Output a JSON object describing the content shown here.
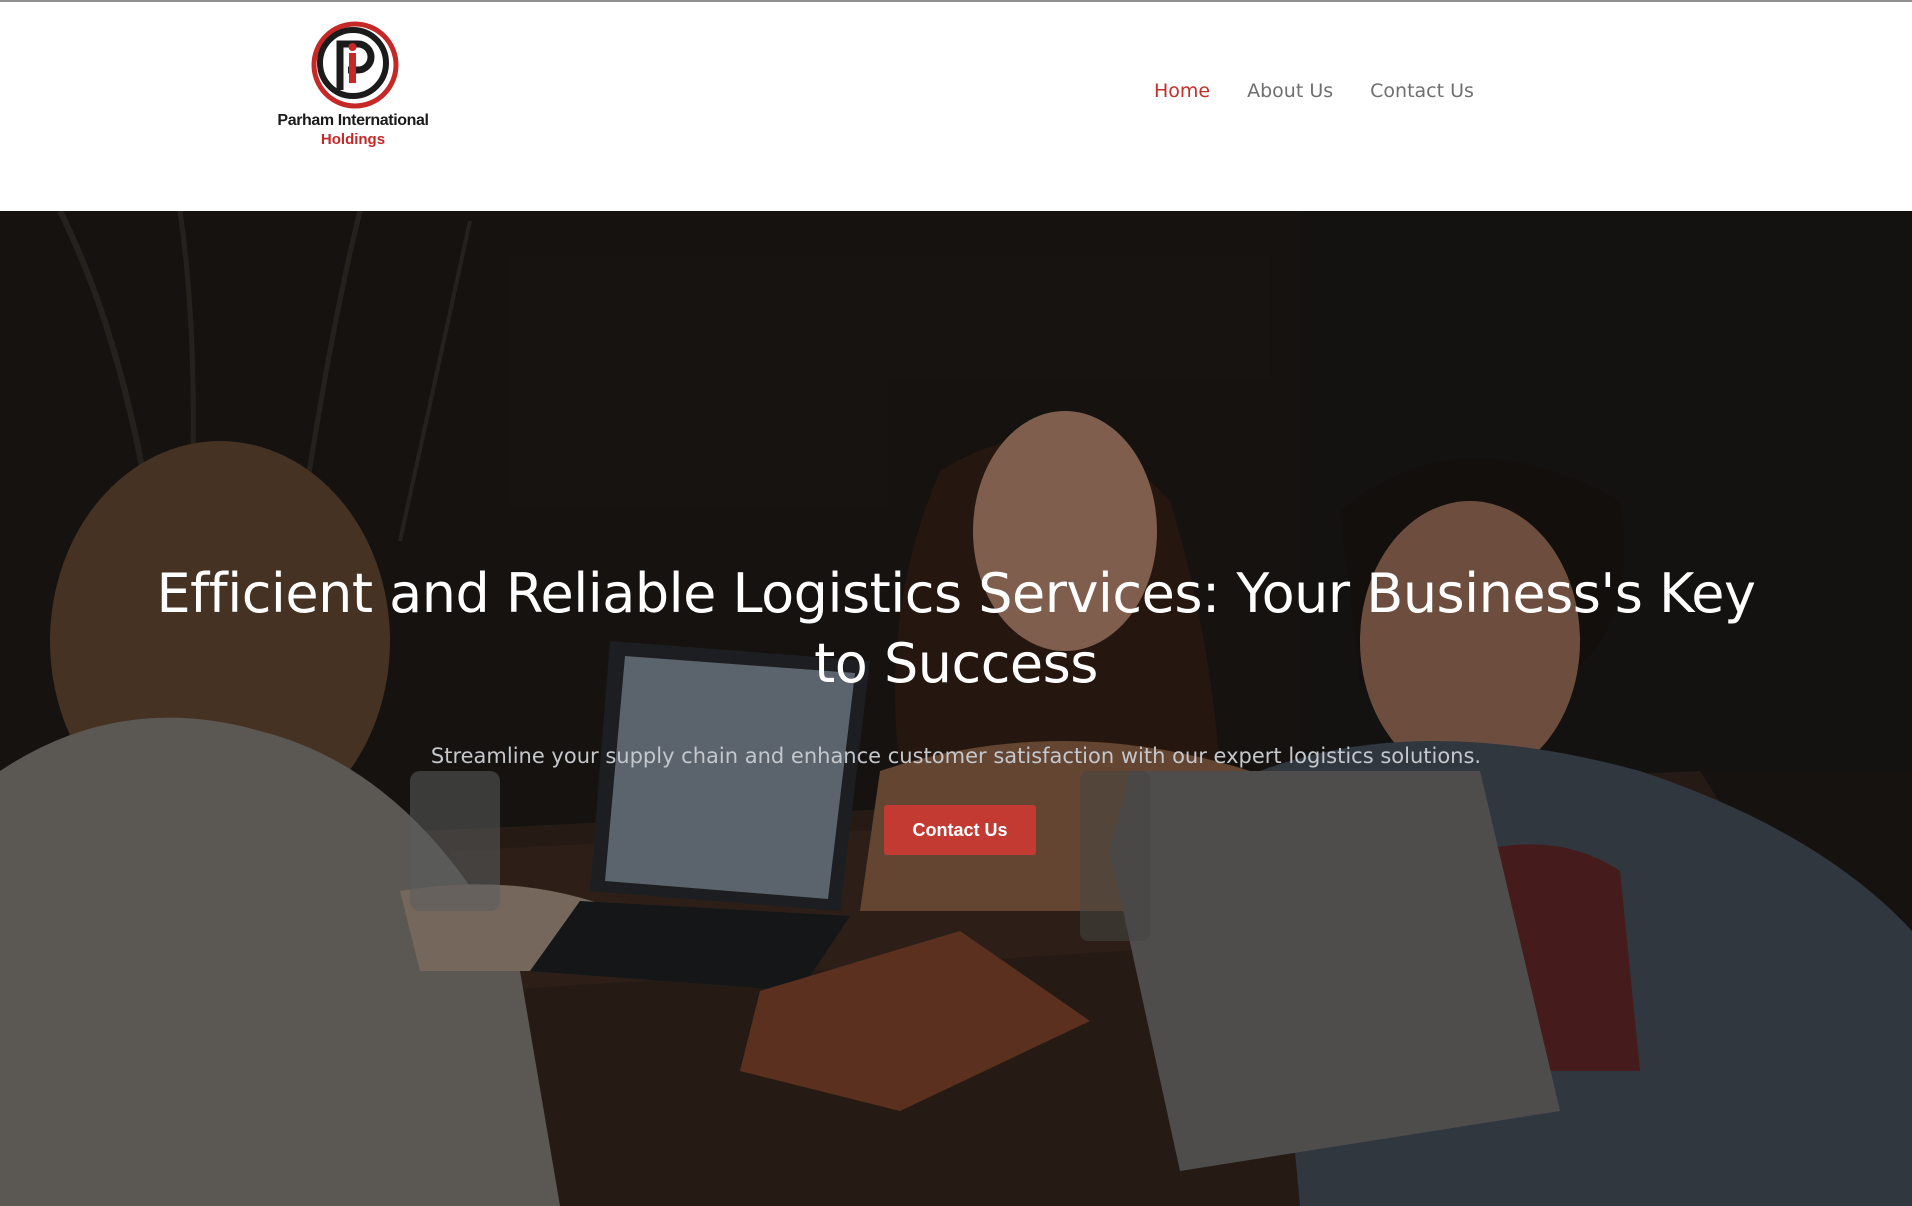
{
  "brand": {
    "name_line1": "Parham International",
    "name_line2": "Holdings",
    "logo_letter_p": "P",
    "logo_letter_i": "i",
    "accent_color": "#c62828",
    "dark_color": "#1b1b1b"
  },
  "nav": {
    "items": [
      {
        "label": "Home",
        "active": true
      },
      {
        "label": "About Us",
        "active": false
      },
      {
        "label": "Contact Us",
        "active": false
      }
    ],
    "active_color": "#c0302a",
    "text_color": "#6f6f6f"
  },
  "hero": {
    "title": "Efficient and Reliable Logistics Services: Your Business's Key to Success",
    "subtitle": "Streamline your supply chain and enhance customer satisfaction with our expert logistics solutions.",
    "cta_label": "Contact Us",
    "cta_color": "#c33a33",
    "background_description_icon": "team-meeting-photo"
  }
}
